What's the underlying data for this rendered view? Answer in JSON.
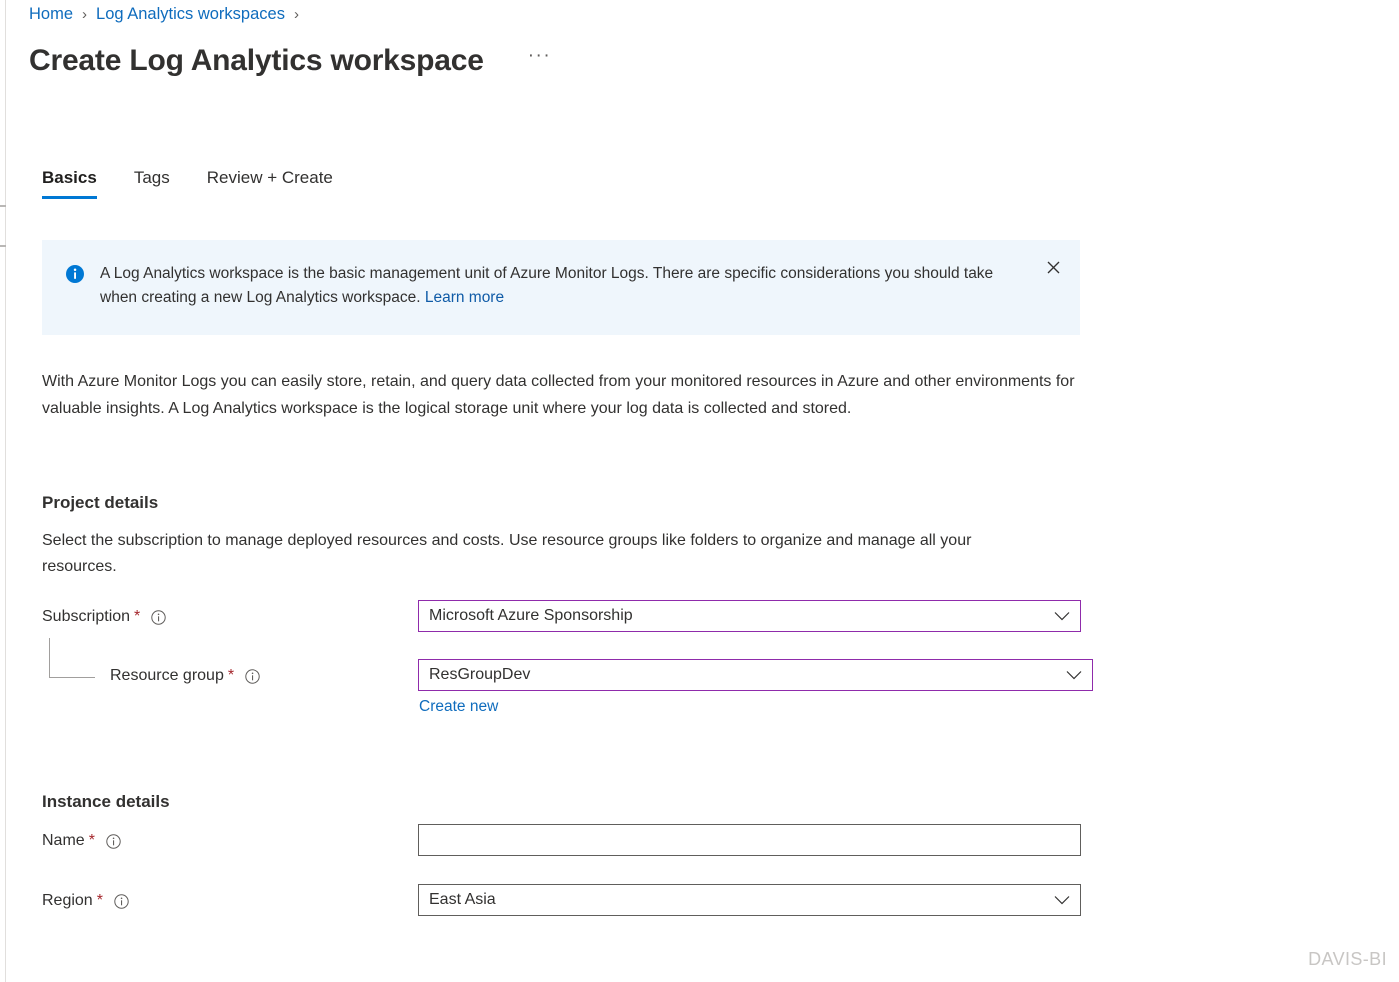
{
  "breadcrumb": {
    "items": [
      {
        "label": "Home"
      },
      {
        "label": "Log Analytics workspaces"
      }
    ],
    "separator": "›"
  },
  "header": {
    "title": "Create Log Analytics workspace",
    "more_menu": "···",
    "more_menu_name": "more-commands-icon"
  },
  "tabs": [
    {
      "label": "Basics",
      "active": true
    },
    {
      "label": "Tags",
      "active": false
    },
    {
      "label": "Review + Create",
      "active": false
    }
  ],
  "banner": {
    "icon": "info-icon",
    "text_before_link": "A Log Analytics workspace is the basic management unit of Azure Monitor Logs. There are specific considerations you should take when creating a new Log Analytics workspace. ",
    "link_label": "Learn more",
    "close_icon": "close-icon"
  },
  "description": "With Azure Monitor Logs you can easily store, retain, and query data collected from your monitored resources in Azure and other environments for valuable insights. A Log Analytics workspace is the logical storage unit where your log data is collected and stored.",
  "project_details": {
    "heading": "Project details",
    "description": "Select the subscription to manage deployed resources and costs. Use resource groups like folders to organize and manage all your resources.",
    "subscription": {
      "label": "Subscription",
      "required_marker": "*",
      "info_icon": "info-circle-icon",
      "value": "Microsoft Azure Sponsorship",
      "chevron": "chevron-down-icon"
    },
    "resource_group": {
      "label": "Resource group",
      "required_marker": "*",
      "info_icon": "info-circle-icon",
      "value": "ResGroupDev",
      "chevron": "chevron-down-icon",
      "create_new_label": "Create new"
    }
  },
  "instance_details": {
    "heading": "Instance details",
    "name": {
      "label": "Name",
      "required_marker": "*",
      "info_icon": "info-circle-icon",
      "value": "",
      "placeholder": ""
    },
    "region": {
      "label": "Region",
      "required_marker": "*",
      "info_icon": "info-circle-icon",
      "value": "East Asia",
      "chevron": "chevron-down-icon"
    }
  },
  "watermark": "DAVIS-BI",
  "colors": {
    "accent_blue": "#0078d4",
    "link_blue": "#0f6cbd",
    "banner_bg": "#eff6fc",
    "banner_link": "#0f5ba7",
    "required_red": "#a4262c",
    "field_accent_border": "#8f2bab",
    "field_border": "#605e5c",
    "watermark_gray": "#c8c6c4"
  }
}
